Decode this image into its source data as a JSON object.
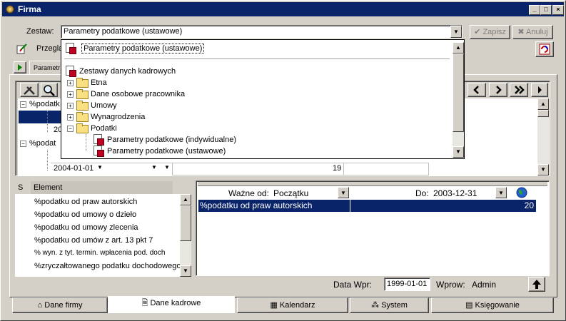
{
  "window": {
    "title": "Firma"
  },
  "header": {
    "zestaw_label": "Zestaw:",
    "zestaw_value": "Parametry podatkowe (ustawowe)",
    "save_label": "Zapisz",
    "cancel_label": "Anuluj",
    "przeglad_label": "Przeglą"
  },
  "dropdown": {
    "selected": "Parametry podatkowe (ustawowe)",
    "root": "Zestawy danych kadrowych",
    "folders": [
      "Etna",
      "Dane osobowe pracownika",
      "Umowy",
      "Wynagrodzenia",
      "Podatki"
    ],
    "podatki_children": [
      "Parametry podatkowe (indywidualne)",
      "Parametry podatkowe (ustawowe)"
    ]
  },
  "inner_tab": {
    "label": "Parametr"
  },
  "grid": {
    "row1_label": "%podatk",
    "row2_label": "%podat",
    "row_partial_date": "20",
    "date_value": "2004-01-01",
    "number_value": "19"
  },
  "element_list": {
    "col_s": "S",
    "col_element": "Element",
    "items": [
      "%podatku od praw autorskich",
      "%podatku od umowy o dzieło",
      "%podatku od umowy zlecenia",
      "%podatku od umów z art. 13 pkt 7",
      "% wyn. z tyt. termin. wpłacenia pod. doch",
      "%zryczałtowanego podatku dochodowego"
    ]
  },
  "detail": {
    "wazne_od_label": "Ważne od:",
    "wazne_od_value": "Początku",
    "do_label": "Do:",
    "do_value": "2003-12-31",
    "row_name": "%podatku od praw autorskich",
    "row_value": "20"
  },
  "footer": {
    "data_wpr_label": "Data Wpr:",
    "data_wpr_value": "1999-01-01",
    "wprow_label": "Wprow:",
    "wprow_value": "Admin"
  },
  "bottom_tabs": [
    "Dane firmy",
    "Dane kadrowe",
    "Kalendarz",
    "System",
    "Księgowanie"
  ],
  "nav": [
    "<",
    ">",
    ">>",
    "▸"
  ],
  "colors": {
    "titlebar": "#0a246a",
    "selection": "#0a246a",
    "face": "#d4d0c8"
  }
}
